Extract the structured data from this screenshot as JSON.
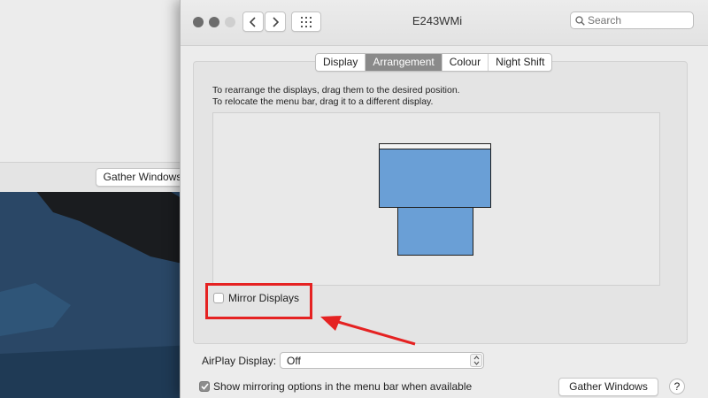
{
  "back_window": {
    "gather_windows_label": "Gather Windows"
  },
  "window": {
    "title": "E243WMi",
    "search_placeholder": "Search",
    "nav_back_icon": "chevron-left-icon",
    "nav_forward_icon": "chevron-right-icon",
    "show_all_icon": "grid-icon"
  },
  "tabs": [
    {
      "label": "Display",
      "active": false
    },
    {
      "label": "Arrangement",
      "active": true
    },
    {
      "label": "Colour",
      "active": false
    },
    {
      "label": "Night Shift",
      "active": false
    }
  ],
  "arrangement": {
    "instruction_1": "To rearrange the displays, drag them to the desired position.",
    "instruction_2": "To relocate the menu bar, drag it to a different display.",
    "display_color": "#6a9fd6"
  },
  "mirror_displays": {
    "label": "Mirror Displays",
    "checked": false
  },
  "airplay": {
    "label": "AirPlay Display:",
    "selected": "Off"
  },
  "show_mirroring": {
    "label": "Show mirroring options in the menu bar when available",
    "checked": true
  },
  "gather_windows_label": "Gather Windows",
  "help_label": "?",
  "colors": {
    "highlight": "#e52222",
    "traffic_close": "#6d6d6d",
    "active_tab": "#8a8a8a"
  }
}
